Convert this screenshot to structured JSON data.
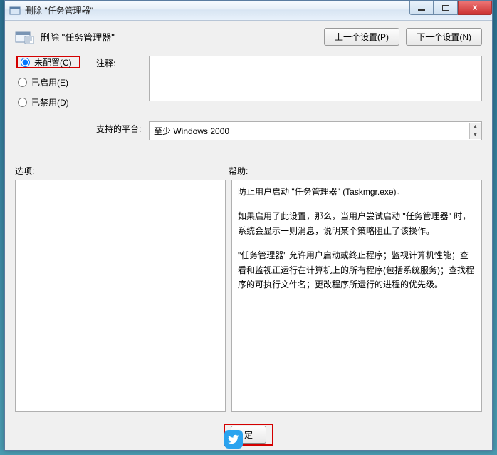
{
  "window": {
    "title": "删除 \"任务管理器\""
  },
  "header": {
    "title": "删除 \"任务管理器\""
  },
  "nav": {
    "prev": "上一个设置(P)",
    "next": "下一个设置(N)"
  },
  "radios": {
    "not_configured": "未配置(C)",
    "enabled": "已启用(E)",
    "disabled": "已禁用(D)",
    "selected": "not_configured"
  },
  "labels": {
    "comment": "注释:",
    "platform": "支持的平台:",
    "options": "选项:",
    "help": "帮助:"
  },
  "fields": {
    "comment_value": "",
    "platform_value": "至少 Windows 2000"
  },
  "help_text": {
    "p1": "防止用户启动 \"任务管理器\" (Taskmgr.exe)。",
    "p2": "如果启用了此设置，那么，当用户尝试启动 \"任务管理器\" 时，系统会显示一则消息，说明某个策略阻止了该操作。",
    "p3": "\"任务管理器\" 允许用户启动或终止程序；监视计算机性能；查看和监视正运行在计算机上的所有程序(包括系统服务)；查找程序的可执行文件名；更改程序所运行的进程的优先级。"
  },
  "footer": {
    "ok": "定"
  }
}
